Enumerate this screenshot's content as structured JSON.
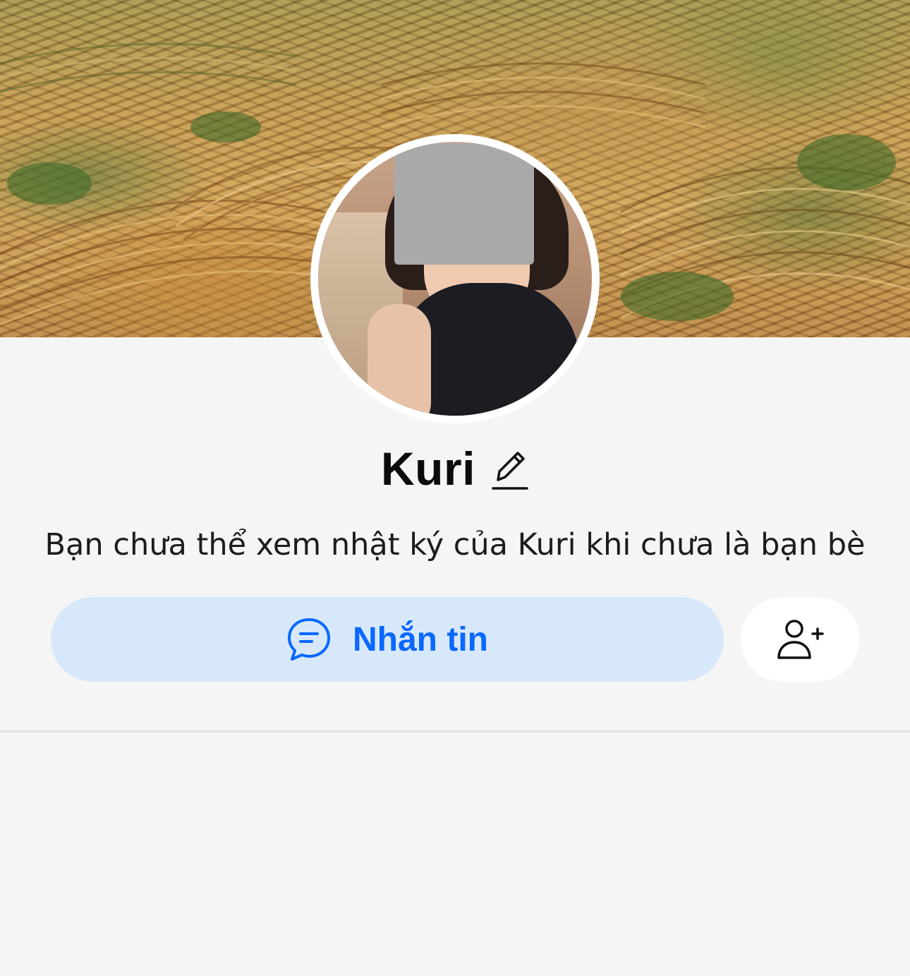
{
  "profile": {
    "name": "Kuri",
    "notice": "Bạn chưa thể xem nhật ký của Kuri khi chưa là bạn bè"
  },
  "actions": {
    "message_label": "Nhắn tin"
  },
  "icons": {
    "edit": "pencil-edit-icon",
    "message": "chat-bubble-icon",
    "add_friend": "add-friend-icon"
  },
  "colors": {
    "accent": "#0a68ff",
    "message_button_bg": "#d8e8fb",
    "page_bg": "#f5f5f5"
  }
}
